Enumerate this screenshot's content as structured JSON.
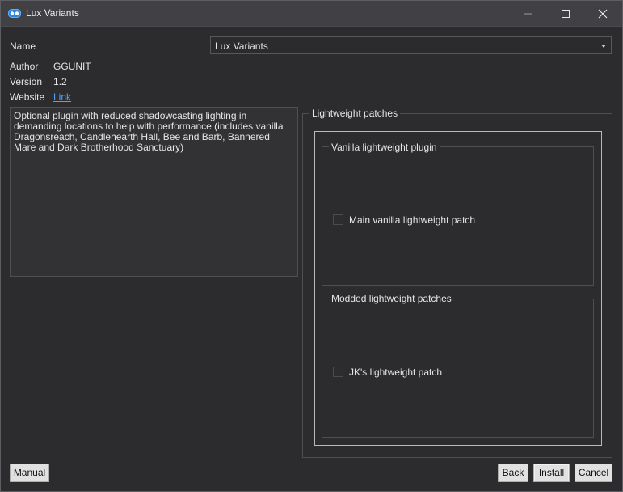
{
  "window": {
    "title": "Lux Variants",
    "icons": {
      "app": "mod-organizer-icon",
      "minimize": "minimize-icon",
      "maximize": "maximize-icon",
      "close": "close-icon"
    }
  },
  "info": {
    "name_label": "Name",
    "name_value": "Lux Variants",
    "author_label": "Author",
    "author_value": "GGUNIT",
    "version_label": "Version",
    "version_value": "1.2",
    "website_label": "Website",
    "website_link": "Link"
  },
  "description": "Optional plugin with reduced shadowcasting lighting in demanding locations to help with performance (includes vanilla Dragonsreach, Candlehearth Hall, Bee and Barb, Bannered Mare and Dark Brotherhood Sanctuary)",
  "options": {
    "title": "Lightweight patches",
    "groups": [
      {
        "title": "Vanilla lightweight plugin",
        "items": [
          {
            "label": "Main vanilla lightweight patch",
            "checked": false
          }
        ]
      },
      {
        "title": "Modded lightweight patches",
        "items": [
          {
            "label": "JK's lightweight patch",
            "checked": false
          }
        ]
      }
    ]
  },
  "buttons": {
    "manual": "Manual",
    "back": "Back",
    "install": "Install",
    "cancel": "Cancel"
  },
  "colors": {
    "background": "#2c2c2f",
    "titlebar": "#414145",
    "link": "#4aa3ff",
    "button_face": "#e1e1e1",
    "default_button_border": "#e2a24d"
  }
}
